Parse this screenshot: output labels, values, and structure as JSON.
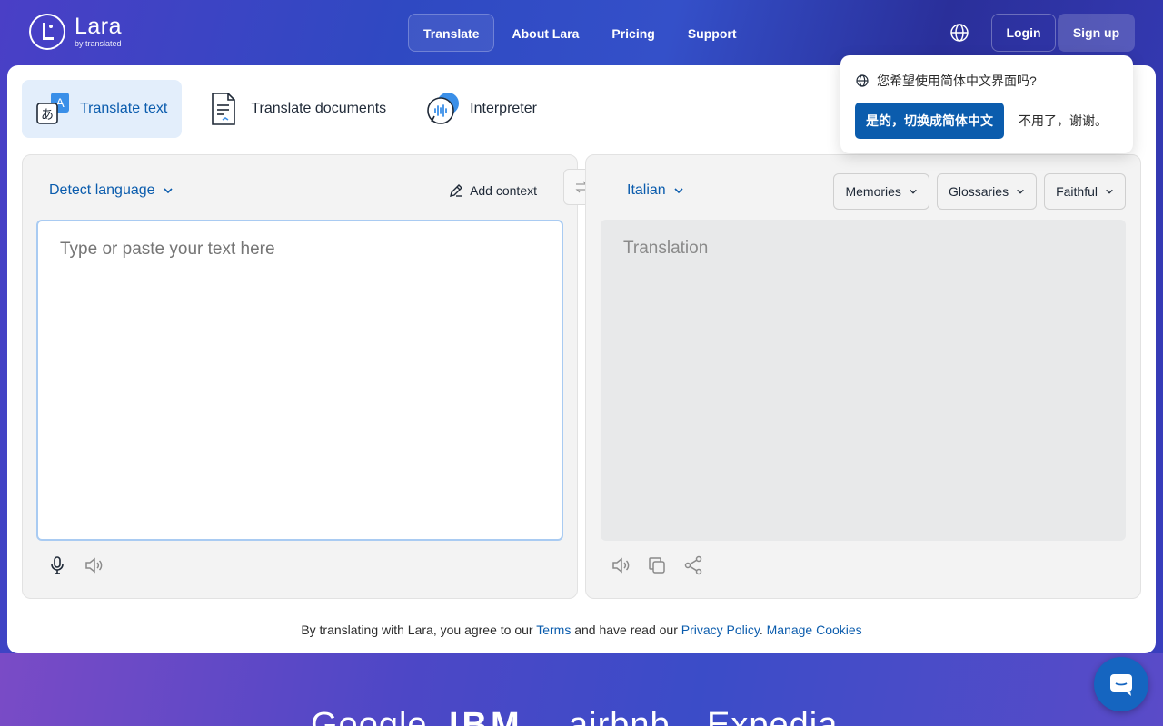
{
  "nav": {
    "logo_name": "Lara",
    "logo_sub": "by translated",
    "links": [
      "Translate",
      "About Lara",
      "Pricing",
      "Support"
    ],
    "login": "Login",
    "signup": "Sign up"
  },
  "modes": [
    "Translate text",
    "Translate documents",
    "Interpreter"
  ],
  "source": {
    "language": "Detect language",
    "add_context": "Add context",
    "placeholder": "Type or paste your text here"
  },
  "target": {
    "language": "Italian",
    "placeholder": "Translation",
    "controls": [
      "Memories",
      "Glossaries",
      "Faithful"
    ]
  },
  "legal": {
    "prefix": "By translating with Lara, you agree to our ",
    "terms": "Terms",
    "middle": " and have read our ",
    "privacy": "Privacy Policy",
    "sep": ". ",
    "cookies": "Manage Cookies"
  },
  "popup": {
    "question": "您希望使用简体中文界面吗?",
    "yes": "是的，切换成简体中文",
    "no": "不用了，谢谢。"
  },
  "brands": [
    "Google",
    "IBM",
    "airbnb",
    "Expedia"
  ],
  "colors": {
    "accent": "#0b5cad",
    "active_tab_bg": "#e3eefb"
  }
}
